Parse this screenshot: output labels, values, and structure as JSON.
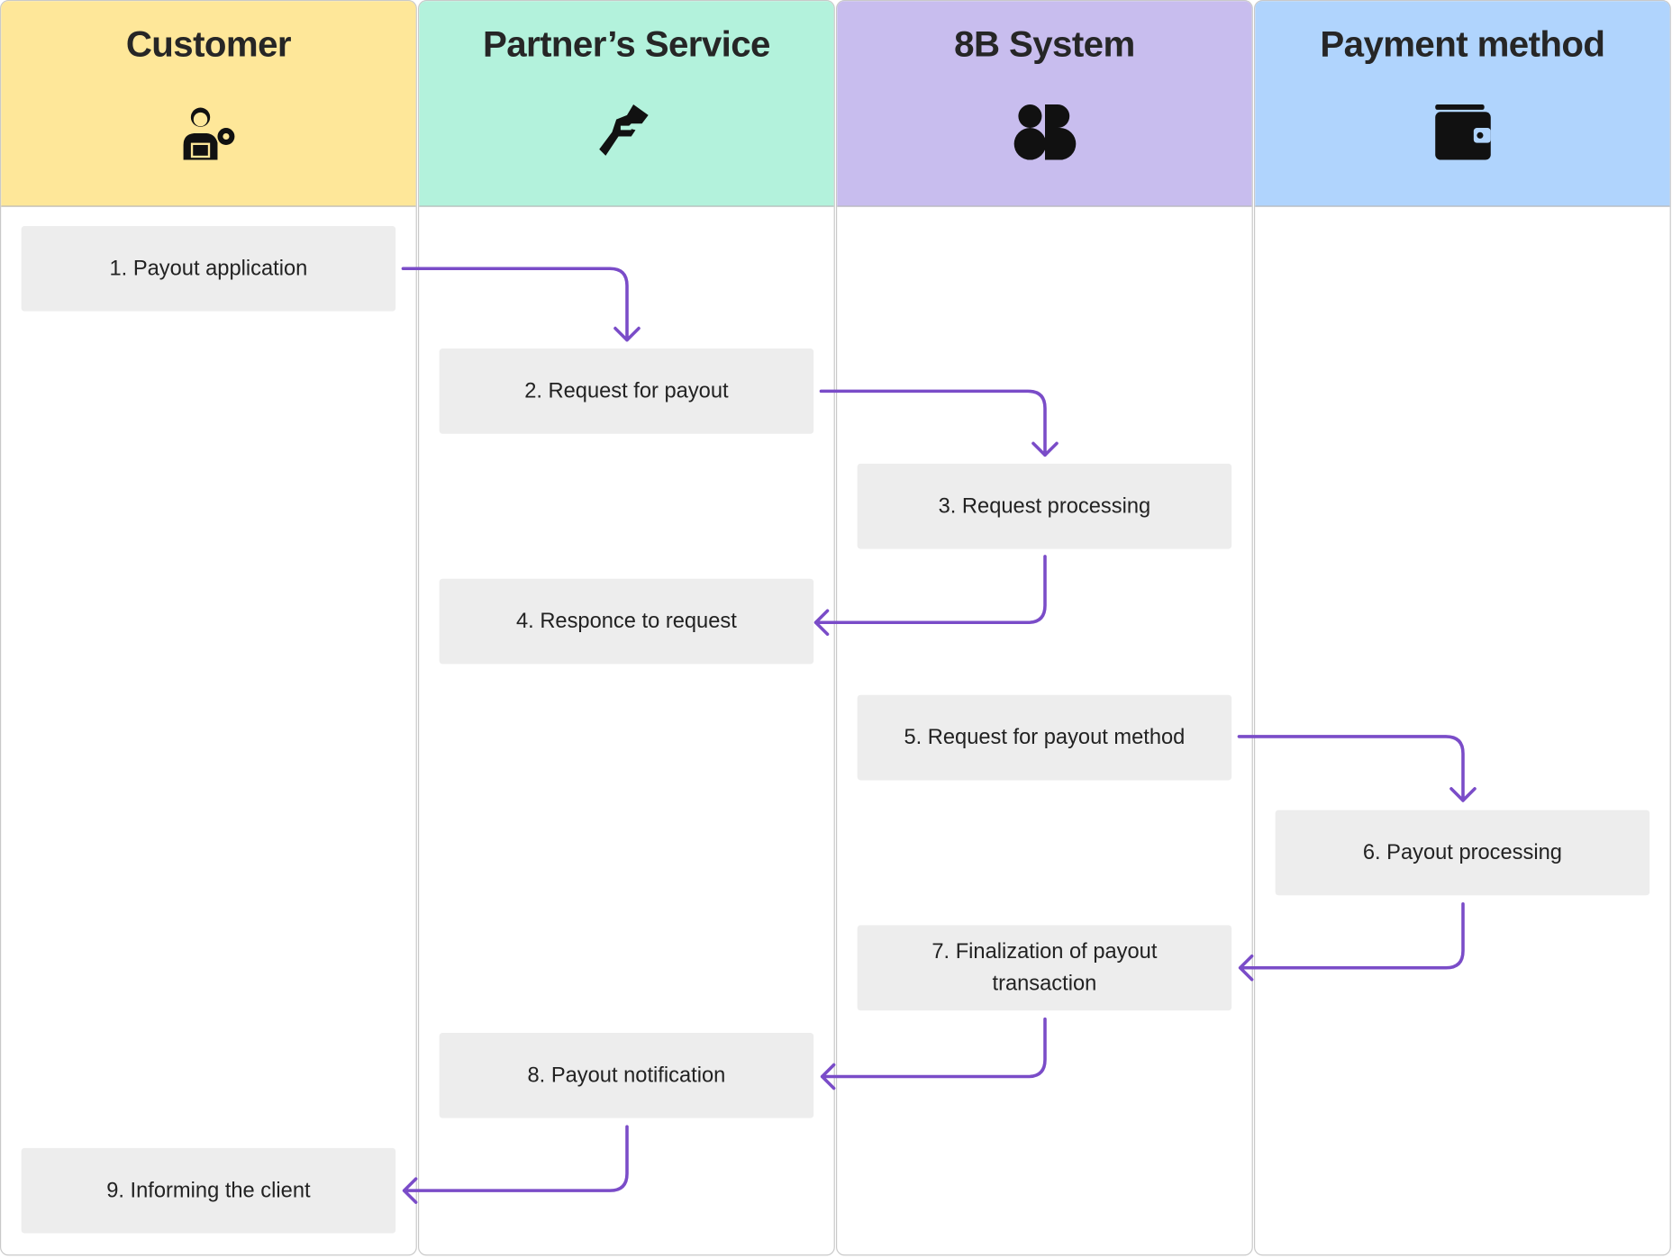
{
  "lanes": [
    {
      "title": "Customer",
      "icon": "customer-support-icon",
      "color": "#fee799"
    },
    {
      "title": "Partner’s Service",
      "icon": "handshake-icon",
      "color": "#b3f2dc"
    },
    {
      "title": "8B System",
      "icon": "8b-logo-icon",
      "color": "#c8bdee"
    },
    {
      "title": "Payment method",
      "icon": "wallet-icon",
      "color": "#b0d4fd"
    }
  ],
  "steps": [
    "1. Payout application",
    "2. Request for payout",
    "3. Request processing",
    "4. Responce to request",
    "5. Request for payout method",
    "6. Payout processing",
    "7. Finalization of payout transaction",
    "8. Payout notification",
    "9. Informing the client"
  ],
  "arrow_color": "#7a4cc8"
}
